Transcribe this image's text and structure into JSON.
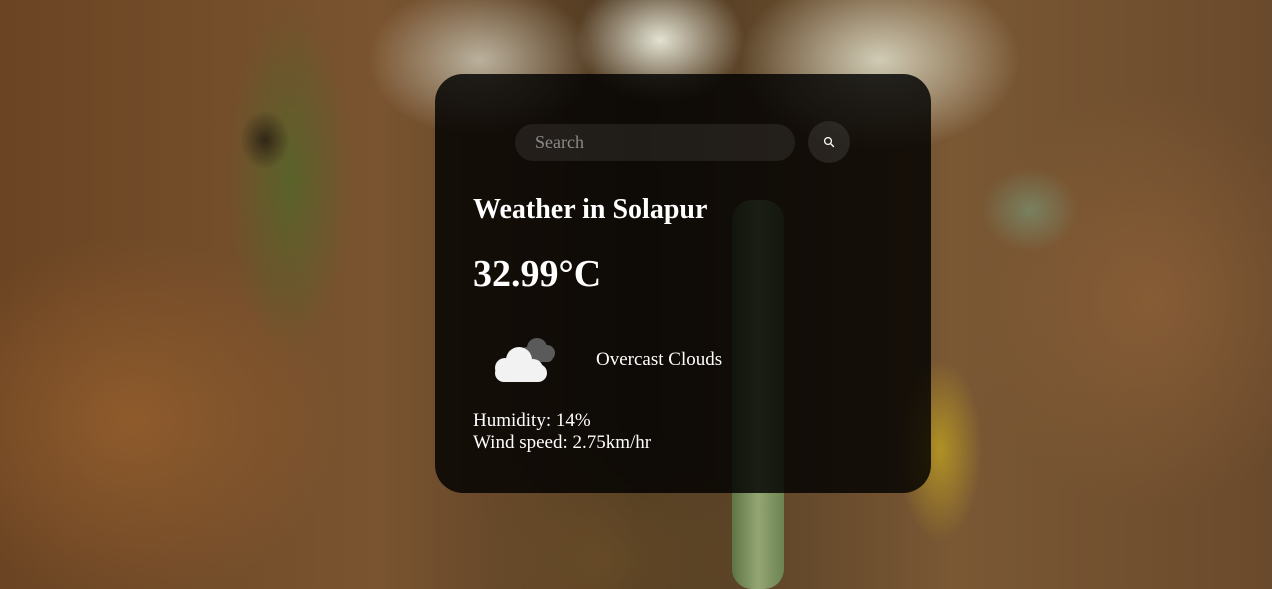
{
  "search": {
    "placeholder": "Search",
    "button_icon": "search-icon"
  },
  "weather": {
    "title": "Weather in Solapur",
    "temperature": "32.99°C",
    "condition_icon": "overcast-clouds-icon",
    "description": "Overcast Clouds",
    "humidity": "Humidity: 14%",
    "wind_speed": "Wind speed: 2.75km/hr"
  },
  "colors": {
    "card_background": "#000000",
    "text": "#ffffff",
    "input_background": "#7c7c7c"
  }
}
